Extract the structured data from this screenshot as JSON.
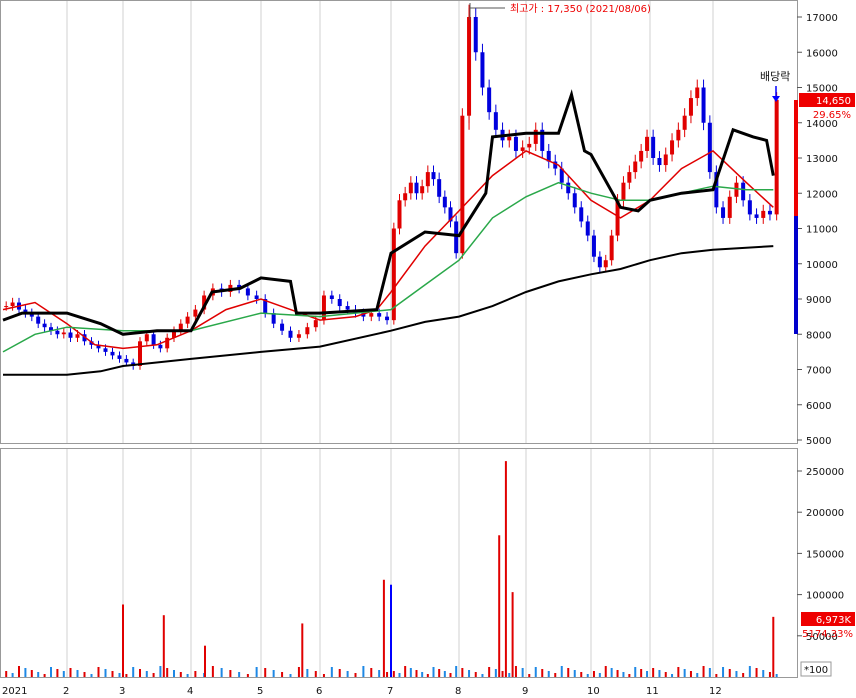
{
  "chart_data": [
    {
      "type": "candlestick",
      "title": "",
      "xlabel": "",
      "ylabel": "",
      "x_tick_labels": [
        "2021",
        "2",
        "3",
        "4",
        "5",
        "6",
        "7",
        "8",
        "9",
        "10",
        "11",
        "12"
      ],
      "y_ticks": [
        17000,
        16000,
        15000,
        14000,
        13000,
        12000,
        11000,
        10000,
        9000,
        8000,
        7000,
        6000,
        5000
      ],
      "y_tick_labels": [
        "17000",
        "16000",
        "15000",
        "14000",
        "13000",
        "12000",
        "11000",
        "10000",
        "9000",
        "8000",
        "7000",
        "6000",
        "5000"
      ],
      "ylim": [
        4900,
        17500
      ],
      "grid": true,
      "max_annotation": "최고가 : 17,350 (2021/08/06)",
      "event_label": "배당락",
      "current_price": "14,650",
      "current_change": "29.65%",
      "close_series": [
        {
          "month": 1,
          "v": [
            8800,
            8900,
            8700,
            8600,
            8500,
            8300,
            8200,
            8100,
            8000,
            8050
          ]
        },
        {
          "month": 2,
          "v": [
            7900,
            8000,
            7800,
            7700,
            7600,
            7500,
            7400,
            7300
          ]
        },
        {
          "month": 3,
          "v": [
            7200,
            7100,
            7800,
            8000,
            7700,
            7600,
            7900,
            8100,
            8300,
            8500
          ]
        },
        {
          "month": 4,
          "v": [
            8700,
            9100,
            9300,
            9200,
            9400,
            9300,
            9100,
            9000
          ]
        },
        {
          "month": 5,
          "v": [
            8600,
            8300,
            8100,
            7900,
            8000,
            8200,
            8400
          ]
        },
        {
          "month": 6,
          "v": [
            9100,
            9000,
            8800,
            8700,
            8600,
            8500,
            8600,
            8500,
            8400
          ]
        },
        {
          "month": 7,
          "v": [
            11000,
            11800,
            12000,
            12300,
            12000,
            12200,
            12600,
            12400,
            11900,
            11600,
            11200,
            10300
          ]
        },
        {
          "month": 8,
          "v": [
            14200,
            17000,
            16000,
            15000,
            14300,
            13800,
            13500,
            13600,
            13200,
            13300
          ]
        },
        {
          "month": 9,
          "v": [
            13400,
            13800,
            13200,
            12900,
            12700,
            12300,
            12000,
            11600,
            11200,
            10800
          ]
        },
        {
          "month": 10,
          "v": [
            10200,
            9900,
            10100,
            10800,
            11800,
            12300,
            12600,
            12900,
            13200,
            13600
          ]
        },
        {
          "month": 11,
          "v": [
            13000,
            12800,
            13100,
            13500,
            13800,
            14200,
            14700,
            15000,
            14000,
            12600
          ]
        },
        {
          "month": 12,
          "v": [
            11600,
            11300,
            11900,
            12300,
            11800,
            11400,
            11300,
            11500,
            11400,
            14650
          ]
        }
      ],
      "moving_averages": [
        {
          "color": "#e00000",
          "points": [
            [
              1,
              8700
            ],
            [
              1.5,
              8900
            ],
            [
              2,
              8300
            ],
            [
              2.5,
              7700
            ],
            [
              3,
              7600
            ],
            [
              3.5,
              7700
            ],
            [
              4,
              8100
            ],
            [
              4.5,
              8700
            ],
            [
              5,
              9000
            ],
            [
              5.5,
              8700
            ],
            [
              6,
              8400
            ],
            [
              6.5,
              8500
            ],
            [
              6.8,
              8700
            ],
            [
              7,
              9200
            ],
            [
              7.5,
              10500
            ],
            [
              8,
              11500
            ],
            [
              8.5,
              12500
            ],
            [
              9,
              13200
            ],
            [
              9.5,
              12800
            ],
            [
              10,
              11800
            ],
            [
              10.5,
              11300
            ],
            [
              11,
              11800
            ],
            [
              11.5,
              12700
            ],
            [
              12,
              13200
            ],
            [
              12.5,
              12300
            ],
            [
              12.9,
              11600
            ]
          ]
        },
        {
          "color": "#2aa84a",
          "points": [
            [
              1,
              7500
            ],
            [
              1.5,
              8000
            ],
            [
              2,
              8200
            ],
            [
              3,
              8100
            ],
            [
              4,
              8100
            ],
            [
              5,
              8600
            ],
            [
              6,
              8500
            ],
            [
              7,
              8700
            ],
            [
              7.5,
              9400
            ],
            [
              8,
              10100
            ],
            [
              8.5,
              11300
            ],
            [
              9,
              11900
            ],
            [
              9.5,
              12300
            ],
            [
              10,
              12000
            ],
            [
              10.5,
              11800
            ],
            [
              11,
              11800
            ],
            [
              11.5,
              12000
            ],
            [
              12,
              12200
            ],
            [
              12.5,
              12100
            ],
            [
              12.9,
              12100
            ]
          ]
        },
        {
          "color": "#000000",
          "points": [
            [
              1,
              6850
            ],
            [
              2,
              6850
            ],
            [
              2.6,
              6950
            ],
            [
              3,
              7100
            ],
            [
              4,
              7300
            ],
            [
              5,
              7500
            ],
            [
              6,
              7650
            ],
            [
              7,
              8100
            ],
            [
              7.5,
              8350
            ],
            [
              8,
              8500
            ],
            [
              8.5,
              8800
            ],
            [
              9,
              9200
            ],
            [
              9.5,
              9500
            ],
            [
              10,
              9700
            ],
            [
              10.5,
              9850
            ],
            [
              11,
              10100
            ],
            [
              11.5,
              10300
            ],
            [
              12,
              10400
            ],
            [
              12.9,
              10500
            ]
          ]
        },
        {
          "color": "#000000",
          "points": [
            [
              1,
              8400
            ],
            [
              1.3,
              8600
            ],
            [
              2,
              8600
            ],
            [
              2.6,
              8300
            ],
            [
              3,
              8000
            ],
            [
              3.5,
              8100
            ],
            [
              4,
              8100
            ],
            [
              4.3,
              9200
            ],
            [
              4.7,
              9300
            ],
            [
              5,
              9600
            ],
            [
              5.5,
              9500
            ],
            [
              5.6,
              8600
            ],
            [
              6,
              8600
            ],
            [
              6.8,
              8700
            ],
            [
              7,
              10300
            ],
            [
              7.5,
              10900
            ],
            [
              8,
              10800
            ],
            [
              8.4,
              12000
            ],
            [
              8.5,
              13600
            ],
            [
              9,
              13700
            ],
            [
              9.5,
              13700
            ],
            [
              9.7,
              14800
            ],
            [
              9.9,
              13200
            ],
            [
              10,
              13100
            ],
            [
              10.5,
              11600
            ],
            [
              10.8,
              11500
            ],
            [
              11,
              11800
            ],
            [
              11.5,
              12000
            ],
            [
              12,
              12100
            ],
            [
              12.3,
              13800
            ],
            [
              12.6,
              13600
            ],
            [
              12.8,
              13500
            ],
            [
              12.9,
              12500
            ]
          ]
        }
      ]
    },
    {
      "type": "bar",
      "title": "",
      "xlabel": "",
      "ylabel": "",
      "y_ticks": [
        250000,
        200000,
        150000,
        100000,
        50000
      ],
      "y_tick_labels": [
        "250000",
        "200000",
        "150000",
        "100000",
        "50000"
      ],
      "ylim": [
        0,
        265000
      ],
      "unit_label": "*100",
      "current_volume": "6,973K",
      "current_volume_change": "5174.33%",
      "volume_spikes": [
        {
          "x": 3.0,
          "v": 88000,
          "color": "#e00000"
        },
        {
          "x": 3.6,
          "v": 75000,
          "color": "#e00000"
        },
        {
          "x": 4.2,
          "v": 38000,
          "color": "#e00000"
        },
        {
          "x": 5.7,
          "v": 65000,
          "color": "#e00000"
        },
        {
          "x": 6.9,
          "v": 118000,
          "color": "#e00000"
        },
        {
          "x": 7.0,
          "v": 112000,
          "color": "#0000ff"
        },
        {
          "x": 8.6,
          "v": 172000,
          "color": "#e00000"
        },
        {
          "x": 8.7,
          "v": 262000,
          "color": "#e00000"
        },
        {
          "x": 8.8,
          "v": 103000,
          "color": "#e00000"
        },
        {
          "x": 12.9,
          "v": 73000,
          "color": "#e00000"
        }
      ]
    }
  ]
}
